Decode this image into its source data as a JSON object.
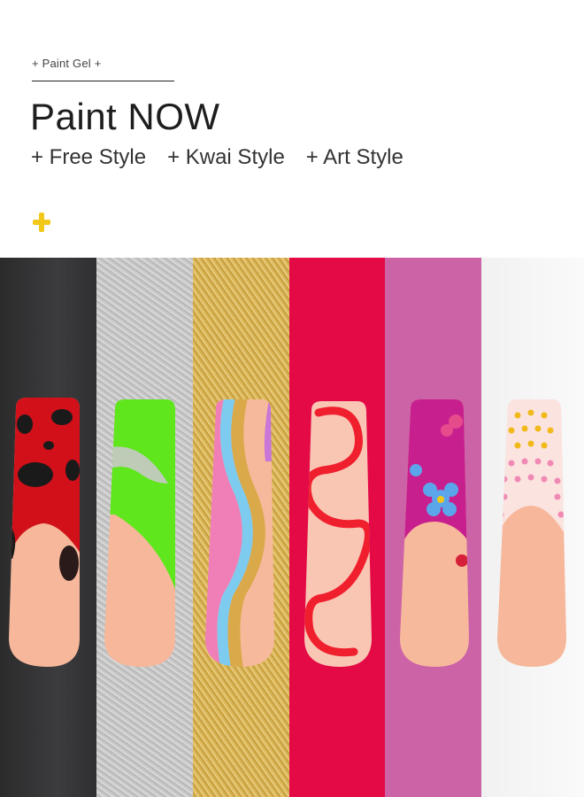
{
  "header": {
    "tag": "+ Paint Gel +",
    "title": "Paint NOW",
    "styles": [
      "+ Free Style",
      "+ Kwai Style",
      "+ Art Style"
    ]
  },
  "colors": {
    "accent_plus": "#f2c91a",
    "swatches": [
      "#323234",
      "#c2c2c2",
      "#d8b457",
      "#e40a46",
      "#cc63a6",
      "#f6f6f6"
    ],
    "nail_base": "#f7b99c"
  },
  "nails": [
    {
      "name": "black-red-spot-nail"
    },
    {
      "name": "green-silver-nail"
    },
    {
      "name": "rainbow-wave-nail"
    },
    {
      "name": "red-swirl-nail"
    },
    {
      "name": "pink-flower-nail"
    },
    {
      "name": "polka-dot-nail"
    }
  ]
}
